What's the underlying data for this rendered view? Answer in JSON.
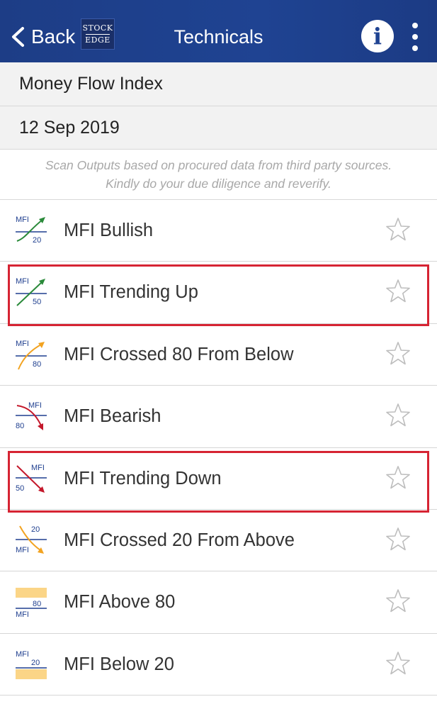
{
  "navbar": {
    "back_label": "Back",
    "logo_line1": "STOCK",
    "logo_line2": "EDGE",
    "title": "Technicals",
    "info_label": "i",
    "background_color": "#1f4392"
  },
  "indicator_header": "Money Flow Index",
  "date_header": "12 Sep 2019",
  "disclaimer": {
    "line1": "Scan Outputs based on procured data from third party sources.",
    "line2": "Kindly do your due diligence and reverify."
  },
  "scans": [
    {
      "label": "MFI Bullish",
      "icon": "mfi-bullish-icon",
      "icon_top": "MFI",
      "icon_bottom": "20",
      "highlighted": false
    },
    {
      "label": "MFI Trending Up",
      "icon": "mfi-trending-up-icon",
      "icon_top": "MFI",
      "icon_bottom": "50",
      "highlighted": true
    },
    {
      "label": "MFI Crossed 80 From Below",
      "icon": "mfi-crossed-80-from-below-icon",
      "icon_top": "MFI",
      "icon_bottom": "80",
      "highlighted": false
    },
    {
      "label": "MFI Bearish",
      "icon": "mfi-bearish-icon",
      "icon_top": "MFI",
      "icon_bottom": "80",
      "highlighted": false
    },
    {
      "label": "MFI Trending Down",
      "icon": "mfi-trending-down-icon",
      "icon_top": "MFI",
      "icon_bottom": "50",
      "highlighted": true
    },
    {
      "label": "MFI Crossed 20 From Above",
      "icon": "mfi-crossed-20-from-above-icon",
      "icon_top": "20",
      "icon_bottom": "MFI",
      "highlighted": false
    },
    {
      "label": "MFI Above 80",
      "icon": "mfi-above-80-icon",
      "icon_top": "80",
      "icon_bottom": "MFI",
      "highlighted": false
    },
    {
      "label": "MFI Below 20",
      "icon": "mfi-below-20-icon",
      "icon_top": "MFI",
      "icon_bottom": "20",
      "highlighted": false
    }
  ],
  "colors": {
    "bullish_green": "#2a8a3a",
    "crossing_orange": "#f2a321",
    "bearish_red": "#c4182b",
    "zone_yellow": "#fbd587",
    "label_blue": "#1f3f8f",
    "highlight_red": "#d62433",
    "star_gray": "#bdbdbd"
  }
}
